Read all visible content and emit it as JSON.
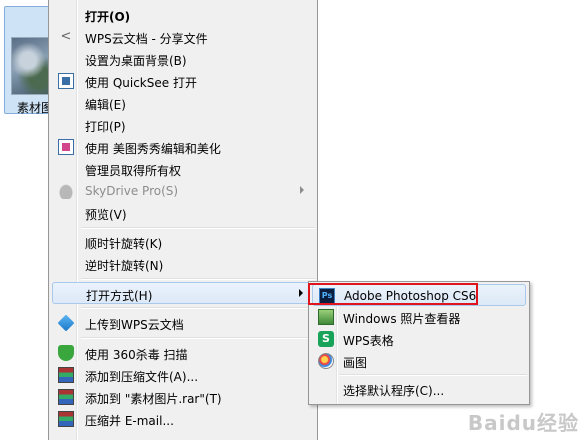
{
  "desktop": {
    "file_label": "素材图片"
  },
  "menu": {
    "items": [
      {
        "label": "打开(O)"
      },
      {
        "label": "WPS云文档 - 分享文件"
      },
      {
        "label": "设置为桌面背景(B)"
      },
      {
        "label": "使用 QuickSee 打开"
      },
      {
        "label": "编辑(E)"
      },
      {
        "label": "打印(P)"
      },
      {
        "label": "使用 美图秀秀编辑和美化"
      },
      {
        "label": "管理员取得所有权"
      },
      {
        "label": "SkyDrive Pro(S)"
      },
      {
        "label": "预览(V)"
      },
      {
        "label": "顺时针旋转(K)"
      },
      {
        "label": "逆时针旋转(N)"
      },
      {
        "label": "打开方式(H)"
      },
      {
        "label": "上传到WPS云文档"
      },
      {
        "label": "使用 360杀毒 扫描"
      },
      {
        "label": "添加到压缩文件(A)..."
      },
      {
        "label": "添加到 \"素材图片.rar\"(T)"
      },
      {
        "label": "压缩并 E-mail..."
      }
    ]
  },
  "submenu": {
    "items": [
      {
        "label": "Adobe Photoshop CS6"
      },
      {
        "label": "Windows 照片查看器"
      },
      {
        "label": "WPS表格"
      },
      {
        "label": "画图"
      },
      {
        "label": "选择默认程序(C)..."
      }
    ]
  },
  "watermark": {
    "text": "Baidu经验"
  },
  "colors": {
    "highlight_border": "#e0141c",
    "hover_bg": "#dde9f7",
    "menu_bg": "#f0f0f0"
  }
}
